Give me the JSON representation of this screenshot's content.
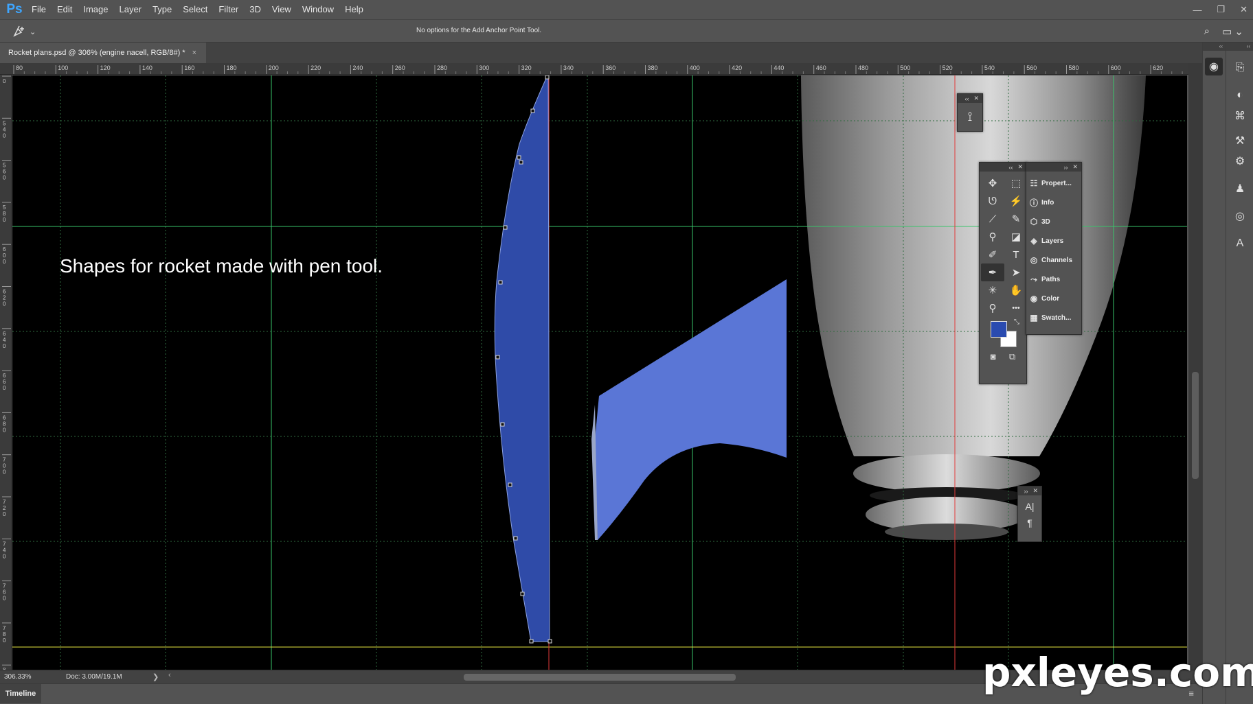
{
  "app": {
    "logo": "Ps"
  },
  "menu": [
    "File",
    "Edit",
    "Image",
    "Layer",
    "Type",
    "Select",
    "Filter",
    "3D",
    "View",
    "Window",
    "Help"
  ],
  "window_controls": {
    "minimize": "—",
    "restore": "❐",
    "close": "✕"
  },
  "options_bar": {
    "message": "No options for the Add Anchor Point Tool.",
    "tool_icon": "pen-plus-icon",
    "dropdown_glyph": "⌄",
    "search_glyph": "⌕",
    "workspace_glyph": "▭ ⌄"
  },
  "document_tab": {
    "title": "Rocket plans.psd @ 306% (engine nacell, RGB/8#) *",
    "close_glyph": "×"
  },
  "ruler": {
    "top_labels": [
      "80",
      "100",
      "120",
      "140",
      "160",
      "180",
      "200",
      "220",
      "240",
      "260",
      "280",
      "300",
      "320",
      "340",
      "360",
      "380",
      "400",
      "420",
      "440",
      "460",
      "480",
      "500",
      "520",
      "540",
      "560",
      "580",
      "600",
      "620"
    ],
    "left_labels": [
      "0",
      "5 4 0",
      "5 6 0",
      "5 8 0",
      "6 0 0",
      "6 2 0",
      "6 4 0",
      "6 6 0",
      "6 8 0",
      "7 0 0",
      "7 2 0",
      "7 4 0",
      "7 6 0",
      "7 8 0",
      "8 0"
    ]
  },
  "canvas": {
    "caption": "Shapes for rocket made with pen tool."
  },
  "colors": {
    "shape_dark": "#2f4ba8",
    "shape_light": "#5a76d6",
    "guide_green": "#39c46a",
    "guide_red": "#e23a3a",
    "guide_yellow": "#e6e640",
    "fg": "#2a4bb0",
    "bg": "#ffffff"
  },
  "status": {
    "zoom": "306.33%",
    "doc": "Doc: 3.00M/19.1M",
    "arrow": "❯",
    "scroll_left": "‹"
  },
  "timeline": {
    "label": "Timeline",
    "menu_glyph": "≡"
  },
  "small_panel_top": {
    "collapse": "‹‹",
    "close": "✕",
    "icon_glyph": "⟟"
  },
  "tools_panel": {
    "collapse": "‹‹",
    "close": "✕",
    "tools": [
      {
        "name": "move-tool",
        "glyph": "✥"
      },
      {
        "name": "marquee-tool",
        "glyph": "⬚"
      },
      {
        "name": "lasso-tool",
        "glyph": "ᘎ"
      },
      {
        "name": "magic-wand-tool",
        "glyph": "⚡"
      },
      {
        "name": "eyedropper-tool",
        "glyph": "⟋"
      },
      {
        "name": "brush-tool",
        "glyph": "✎"
      },
      {
        "name": "stamp-tool",
        "glyph": "⚲"
      },
      {
        "name": "eraser-tool",
        "glyph": "◪"
      },
      {
        "name": "gradient-tool",
        "glyph": "✐"
      },
      {
        "name": "type-tool",
        "glyph": "T"
      },
      {
        "name": "pen-tool",
        "glyph": "✒"
      },
      {
        "name": "path-select-tool",
        "glyph": "➤"
      },
      {
        "name": "shape-tool",
        "glyph": "✳"
      },
      {
        "name": "hand-tool",
        "glyph": "✋"
      },
      {
        "name": "zoom-tool",
        "glyph": "⚲"
      },
      {
        "name": "more-tools",
        "glyph": "•••"
      }
    ],
    "swap_glyph": "⤡",
    "mode_glyph_a": "◙",
    "mode_glyph_b": "⧉"
  },
  "panels_list": {
    "collapse": "››",
    "close": "✕",
    "items": [
      {
        "label": "Propert...",
        "glyph": "☷"
      },
      {
        "label": "Info",
        "glyph": "ⓘ"
      },
      {
        "label": "3D",
        "glyph": "⬡"
      },
      {
        "label": "Layers",
        "glyph": "◈"
      },
      {
        "label": "Channels",
        "glyph": "◎"
      },
      {
        "label": "Paths",
        "glyph": "⤳"
      },
      {
        "label": "Color",
        "glyph": "◉"
      },
      {
        "label": "Swatch...",
        "glyph": "▦"
      }
    ]
  },
  "char_panel": {
    "collapse": "››",
    "close": "✕",
    "char_glyph": "A|",
    "para_glyph": "¶"
  },
  "dock_a": {
    "collapse": "‹‹",
    "icon": "◉"
  },
  "dock_b": {
    "collapse": "‹‹",
    "icons": [
      "⎘",
      "◐",
      "⌘",
      "⚒",
      "⚙",
      "♟",
      "◎",
      "A"
    ]
  },
  "watermark": "pxleyes.com"
}
